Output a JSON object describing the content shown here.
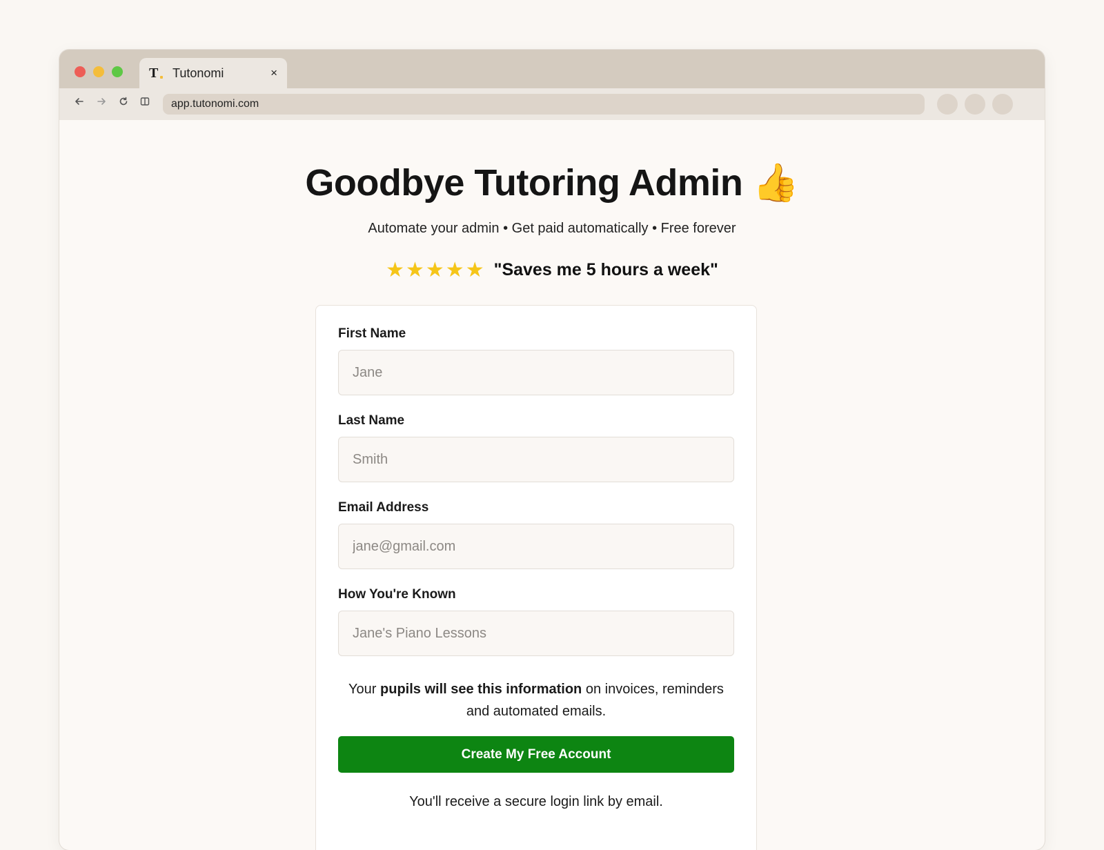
{
  "browser": {
    "tab_title": "Tutonomi",
    "tab_favicon": "T",
    "tab_close": "×",
    "url": "app.tutonomi.com",
    "icons": [
      "back-arrow-icon",
      "forward-arrow-icon",
      "reload-icon",
      "reader-icon"
    ]
  },
  "hero": {
    "title": "Goodbye Tutoring Admin 👍",
    "subtitle": "Automate your admin • Get paid automatically • Free forever",
    "stars": "★★★★★",
    "quote": "\"Saves me 5 hours a week\""
  },
  "form": {
    "first_name": {
      "label": "First Name",
      "placeholder": "Jane"
    },
    "last_name": {
      "label": "Last Name",
      "placeholder": "Smith"
    },
    "email": {
      "label": "Email Address",
      "placeholder": "jane@gmail.com"
    },
    "known_as": {
      "label": "How You're Known",
      "placeholder": "Jane's Piano Lessons"
    },
    "info_prefix": "Your ",
    "info_bold": "pupils will see this information",
    "info_suffix": " on invoices, reminders and automated emails.",
    "submit_label": "Create My Free Account",
    "footnote": "You'll receive a secure login link by email."
  },
  "colors": {
    "accent_green": "#0d8512",
    "star_yellow": "#f5c518",
    "page_bg": "#faf7f3",
    "titlebar": "#d4cbbf"
  }
}
